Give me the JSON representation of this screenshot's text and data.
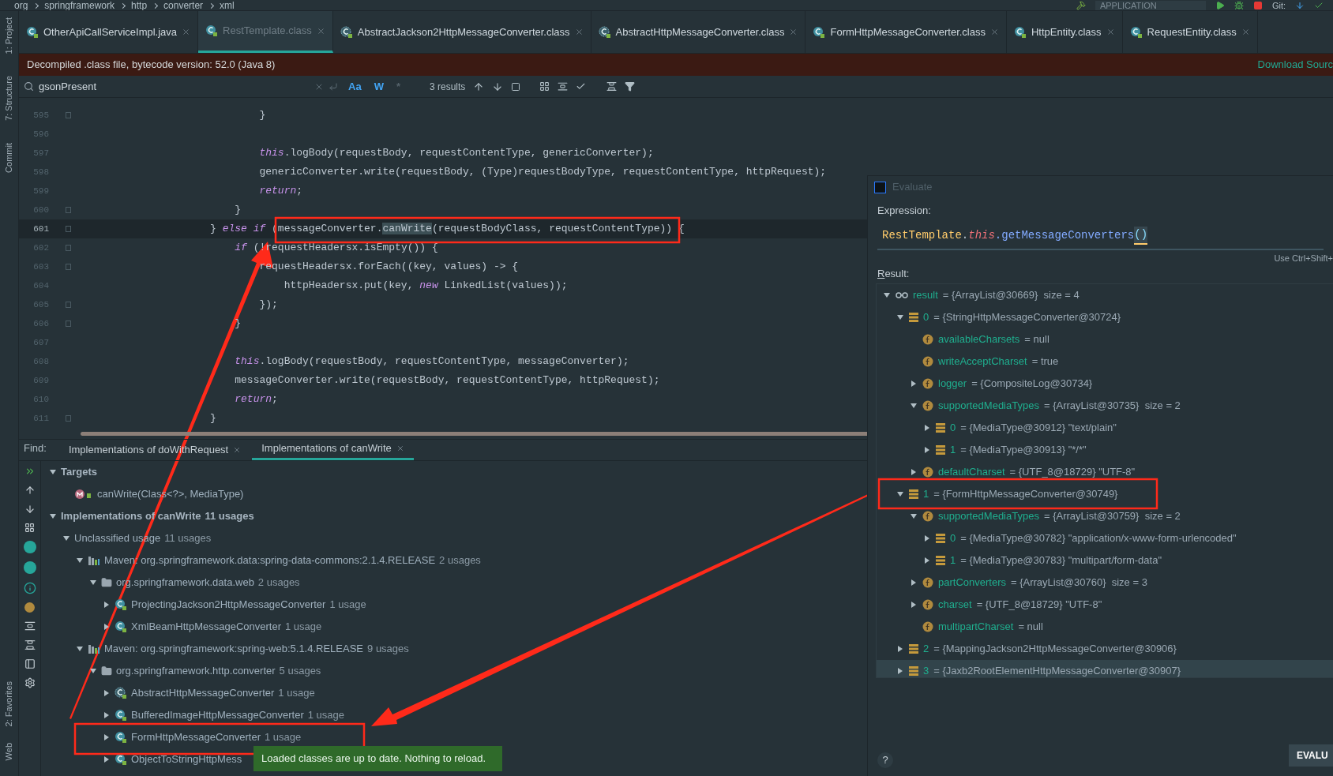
{
  "breadcrumbs": [
    "org",
    "springframework",
    "http",
    "converter",
    "xml"
  ],
  "run_config": "APPLICATION",
  "vcs_label": "Git:",
  "side_tabs_top": [
    "1: Project",
    "7: Structure",
    "Commit"
  ],
  "side_tabs_bottom": [
    "2: Favorites",
    "Web"
  ],
  "editor_tabs": [
    {
      "label": "OtherApiCallServiceImpl.java",
      "selected": false,
      "kind": "class"
    },
    {
      "label": "RestTemplate.class",
      "selected": true,
      "kind": "class"
    },
    {
      "label": "AbstractJackson2HttpMessageConverter.class",
      "selected": false,
      "kind": "abstract"
    },
    {
      "label": "AbstractHttpMessageConverter.class",
      "selected": false,
      "kind": "abstract"
    },
    {
      "label": "FormHttpMessageConverter.class",
      "selected": false,
      "kind": "class"
    },
    {
      "label": "HttpEntity.class",
      "selected": false,
      "kind": "class"
    },
    {
      "label": "RequestEntity.class",
      "selected": false,
      "kind": "class"
    }
  ],
  "banner": {
    "text": "Decompiled .class file, bytecode version: 52.0 (Java 8)",
    "action": "Download Sourc"
  },
  "search": {
    "value": "gsonPresent",
    "toggles": [
      {
        "label": "Aa",
        "on": true
      },
      {
        "label": "W",
        "on": true
      },
      {
        "label": "*",
        "on": false
      }
    ],
    "results": "3 results"
  },
  "code_lines": [
    {
      "number": "595",
      "fold": true,
      "current": false,
      "tokens": [
        {
          "t": "                            }",
          "kind": "plain"
        }
      ]
    },
    {
      "number": "596",
      "current": false
    },
    {
      "number": "597",
      "current": false,
      "tokens": [
        {
          "t": "                            this",
          "kind": "kw"
        },
        {
          "t": ".logBody(requestBody, requestContentType, genericConverter);",
          "kind": "plain"
        }
      ]
    },
    {
      "number": "598",
      "current": false,
      "tokens": [
        {
          "t": "                            genericConverter.write(requestBody, (Type)requestBodyType, requestContentType, httpRequest);",
          "kind": "plain"
        }
      ]
    },
    {
      "number": "599",
      "current": false,
      "tokens": [
        {
          "t": "                            return",
          "kind": "kw"
        },
        {
          "t": ";",
          "kind": "plain"
        }
      ]
    },
    {
      "number": "600",
      "fold": true,
      "current": false,
      "tokens": [
        {
          "t": "                        }",
          "kind": "plain"
        }
      ]
    },
    {
      "number": "601",
      "fold": true,
      "current": true,
      "tokens": [
        {
          "t": "                    } ",
          "kind": "plain"
        },
        {
          "t": "else if",
          "kind": "kw"
        },
        {
          "t": " (messageConverter.",
          "kind": "plain"
        },
        {
          "t": "canWrite",
          "kind": "hl"
        },
        {
          "t": "(requestBodyClass, requestContentType)) {",
          "kind": "plain"
        }
      ]
    },
    {
      "number": "602",
      "fold": true,
      "current": false,
      "tokens": [
        {
          "t": "                        if",
          "kind": "kw"
        },
        {
          "t": " (!requestHeadersx.isEmpty()) {",
          "kind": "plain"
        }
      ]
    },
    {
      "number": "603",
      "fold": true,
      "current": false,
      "tokens": [
        {
          "t": "                            requestHeadersx.forEach((key, values) -> {",
          "kind": "plain"
        }
      ]
    },
    {
      "number": "604",
      "current": false,
      "tokens": [
        {
          "t": "                                httpHeadersx.put(key, ",
          "kind": "plain"
        },
        {
          "t": "new",
          "kind": "kw"
        },
        {
          "t": " LinkedList(values));",
          "kind": "plain"
        }
      ]
    },
    {
      "number": "605",
      "fold": true,
      "current": false,
      "tokens": [
        {
          "t": "                            });",
          "kind": "plain"
        }
      ]
    },
    {
      "number": "606",
      "fold": true,
      "current": false,
      "tokens": [
        {
          "t": "                        }",
          "kind": "plain"
        }
      ]
    },
    {
      "number": "607",
      "current": false
    },
    {
      "number": "608",
      "current": false,
      "tokens": [
        {
          "t": "                        this",
          "kind": "kw"
        },
        {
          "t": ".logBody(requestBody, requestContentType, messageConverter);",
          "kind": "plain"
        }
      ]
    },
    {
      "number": "609",
      "current": false,
      "tokens": [
        {
          "t": "                        messageConverter.write(requestBody, requestContentType, httpRequest);",
          "kind": "plain"
        }
      ]
    },
    {
      "number": "610",
      "current": false,
      "tokens": [
        {
          "t": "                        return",
          "kind": "kw"
        },
        {
          "t": ";",
          "kind": "plain"
        }
      ]
    },
    {
      "number": "611",
      "fold": true,
      "current": false,
      "tokens": [
        {
          "t": "                    }",
          "kind": "plain"
        }
      ]
    }
  ],
  "find": {
    "label": "Find:",
    "tabs": [
      {
        "label": "Implementations of doWithRequest",
        "selected": false
      },
      {
        "label": "Implementations of canWrite",
        "selected": true
      }
    ],
    "tree": [
      {
        "kind": "group",
        "text": "Targets",
        "expanded": true,
        "children": [
          {
            "kind": "method",
            "text": "canWrite(Class<?>, MediaType)"
          }
        ]
      },
      {
        "kind": "group",
        "text": "Implementations of canWrite",
        "count": "11 usages",
        "expanded": true,
        "children": [
          {
            "kind": "plain",
            "text": "Unclassified usage",
            "count": "11 usages",
            "expanded": true,
            "children": [
              {
                "kind": "module",
                "text": "Maven: org.springframework.data:spring-data-commons:2.1.4.RELEASE",
                "count": "2 usages",
                "expanded": true,
                "children": [
                  {
                    "kind": "package",
                    "text": "org.springframework.data.web",
                    "count": "2 usages",
                    "expanded": true,
                    "children": [
                      {
                        "kind": "class",
                        "text": "ProjectingJackson2HttpMessageConverter",
                        "count": "1 usage",
                        "expanded": false
                      },
                      {
                        "kind": "class",
                        "text": "XmlBeamHttpMessageConverter",
                        "count": "1 usage",
                        "expanded": false
                      }
                    ]
                  }
                ]
              },
              {
                "kind": "module",
                "text": "Maven: org.springframework:spring-web:5.1.4.RELEASE",
                "count": "9 usages",
                "expanded": true,
                "children": [
                  {
                    "kind": "package",
                    "text": "org.springframework.http.converter",
                    "count": "5 usages",
                    "expanded": true,
                    "children": [
                      {
                        "kind": "abstract",
                        "text": "AbstractHttpMessageConverter",
                        "count": "1 usage",
                        "expanded": false
                      },
                      {
                        "kind": "class",
                        "text": "BufferedImageHttpMessageConverter",
                        "count": "1 usage",
                        "expanded": false
                      },
                      {
                        "kind": "class",
                        "text": "FormHttpMessageConverter",
                        "count": "1 usage",
                        "expanded": false
                      },
                      {
                        "kind": "class",
                        "text": "ObjectToStringHttpMess",
                        "expanded": false
                      }
                    ]
                  }
                ]
              }
            ]
          }
        ]
      }
    ]
  },
  "evaluate": {
    "title": "Evaluate",
    "expression_label": "Expression:",
    "expression": [
      {
        "t": "RestTemplate",
        "kind": "type"
      },
      {
        "t": ".",
        "kind": "plain"
      },
      {
        "t": "this",
        "kind": "self"
      },
      {
        "t": ".getMessageConverters",
        "kind": "method"
      },
      {
        "t": "()",
        "kind": "match"
      }
    ],
    "hint": "Use Ctrl+Shift+",
    "result_label": "Result:",
    "tree": [
      {
        "kind": "watch",
        "name": "result",
        "value": "= {ArrayList@30669}  size = 4",
        "expanded": true,
        "selected": false,
        "children": [
          {
            "kind": "item",
            "name": "0",
            "value": "= {StringHttpMessageConverter@30724}",
            "expanded": true,
            "selected": false,
            "children": [
              {
                "kind": "field",
                "name": "availableCharsets",
                "value": "= null",
                "selected": false
              },
              {
                "kind": "field",
                "name": "writeAcceptCharset",
                "value": "= true",
                "selected": false
              },
              {
                "kind": "field",
                "name": "logger",
                "value": "= {CompositeLog@30734}",
                "expanded": false,
                "selected": false
              },
              {
                "kind": "field",
                "name": "supportedMediaTypes",
                "value": "= {ArrayList@30735}  size = 2",
                "expanded": true,
                "selected": false,
                "children": [
                  {
                    "kind": "item",
                    "name": "0",
                    "value": "= {MediaType@30912} \"text/plain\"",
                    "expanded": false,
                    "selected": false
                  },
                  {
                    "kind": "item",
                    "name": "1",
                    "value": "= {MediaType@30913} \"*/*\"",
                    "expanded": false,
                    "selected": false
                  }
                ]
              },
              {
                "kind": "field",
                "name": "defaultCharset",
                "value": "= {UTF_8@18729} \"UTF-8\"",
                "expanded": false,
                "selected": false
              }
            ]
          },
          {
            "kind": "item",
            "name": "1",
            "value": "= {FormHttpMessageConverter@30749}",
            "expanded": true,
            "selected": false,
            "children": [
              {
                "kind": "field",
                "name": "supportedMediaTypes",
                "value": "= {ArrayList@30759}  size = 2",
                "expanded": true,
                "selected": false,
                "children": [
                  {
                    "kind": "item",
                    "name": "0",
                    "value": "= {MediaType@30782} \"application/x-www-form-urlencoded\"",
                    "expanded": false,
                    "selected": false
                  },
                  {
                    "kind": "item",
                    "name": "1",
                    "value": "= {MediaType@30783} \"multipart/form-data\"",
                    "expanded": false,
                    "selected": false
                  }
                ]
              },
              {
                "kind": "field",
                "name": "partConverters",
                "value": "= {ArrayList@30760}  size = 3",
                "expanded": false,
                "selected": false
              },
              {
                "kind": "field",
                "name": "charset",
                "value": "= {UTF_8@18729} \"UTF-8\"",
                "expanded": false,
                "selected": false
              },
              {
                "kind": "field",
                "name": "multipartCharset",
                "value": "= null",
                "selected": false
              }
            ]
          },
          {
            "kind": "item",
            "name": "2",
            "value": "= {MappingJackson2HttpMessageConverter@30906}",
            "expanded": false,
            "selected": false
          },
          {
            "kind": "item",
            "name": "3",
            "value": "= {Jaxb2RootElementHttpMessageConverter@30907}",
            "expanded": false,
            "selected": true
          }
        ]
      }
    ],
    "help": "?",
    "button": "EVALU"
  },
  "toast": "Loaded classes are up to date. Nothing to reload."
}
